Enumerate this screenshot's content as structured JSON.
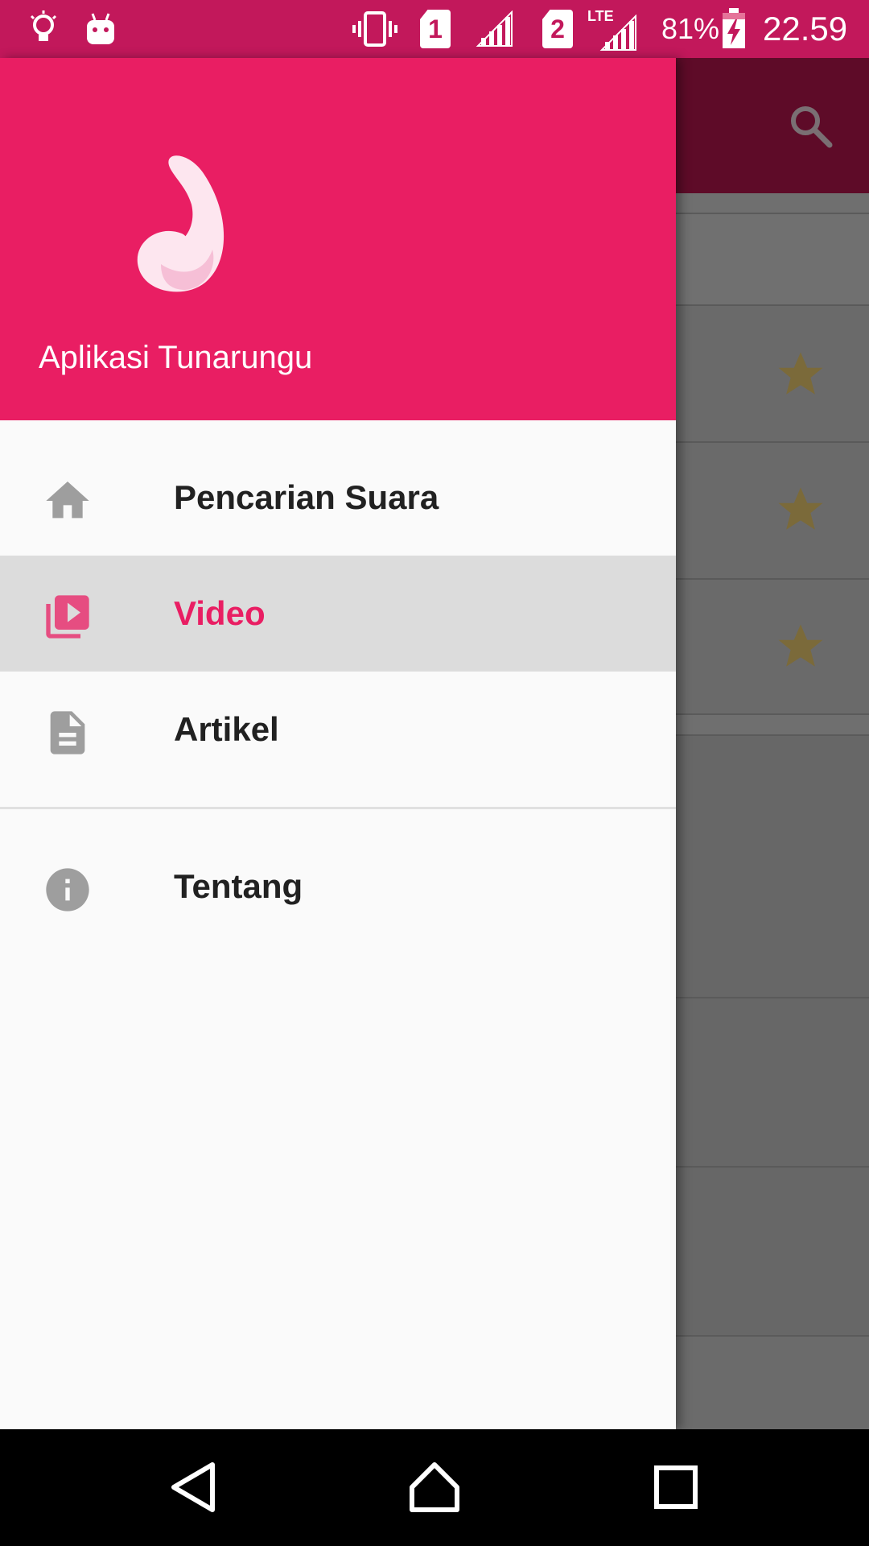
{
  "status_bar": {
    "battery_percent": "81%",
    "time": "22.59",
    "network_label": "LTE",
    "sim1_label": "1",
    "sim2_label": "2",
    "icons": [
      "bulb-icon",
      "android-debug-icon",
      "vibrate-icon",
      "sim1-icon",
      "signal-icon",
      "sim2-icon",
      "lte-signal-icon",
      "battery-charging-icon"
    ]
  },
  "drawer": {
    "app_title": "Aplikasi Tunarungu",
    "items": [
      {
        "label": "Pencarian Suara",
        "icon": "home-icon",
        "active": false
      },
      {
        "label": "Video",
        "icon": "video-library-icon",
        "active": true
      },
      {
        "label": "Artikel",
        "icon": "document-icon",
        "active": false
      }
    ],
    "secondary_items": [
      {
        "label": "Tentang",
        "icon": "info-icon",
        "active": false
      }
    ]
  },
  "background": {
    "toolbar_icon": "search-icon",
    "favorites_icon": "star-icon"
  },
  "nav_bar": {
    "buttons": [
      "back-icon",
      "home-nav-icon",
      "recents-icon"
    ]
  },
  "colors": {
    "status_bar": "#c2185b",
    "header": "#e91e63",
    "accent": "#e91e63",
    "active_row": "#dcdcdc",
    "icon_gray": "#9e9e9e",
    "star": "#7b6a3a"
  }
}
